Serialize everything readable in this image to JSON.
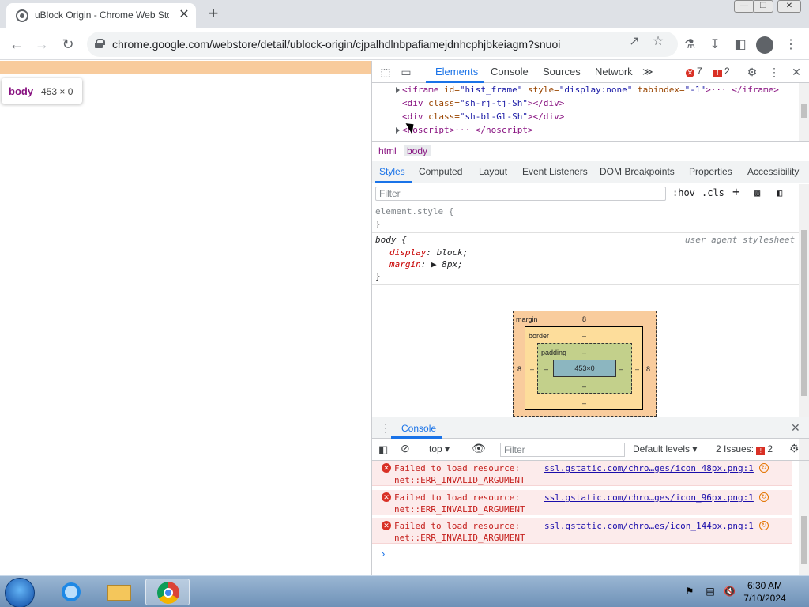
{
  "tab": {
    "title": "uBlock Origin - Chrome Web Sto",
    "close": "✕"
  },
  "newtab": "+",
  "window": {
    "minimize": "—",
    "restore": "❐",
    "close": "✕"
  },
  "address": {
    "url": "chrome.google.com/webstore/detail/ublock-origin/cjpalhdlnbpafiamejdnhcphjbkeiagm?snuoi"
  },
  "tooltip": {
    "tag": "body",
    "dims": "453 × 0"
  },
  "devtools": {
    "tabs": [
      "Elements",
      "Console",
      "Sources",
      "Network"
    ],
    "more": "≫",
    "errors": "7",
    "issues": "2",
    "dom": [
      {
        "open": "<iframe ",
        "attr1": "id=",
        "val1": "\"hist_frame\"",
        "attr2": " style=",
        "val2": "\"display:none\"",
        "attr3": " tabindex=",
        "val3": "\"-1\"",
        "rest": ">··· </iframe>"
      },
      {
        "open": "<div ",
        "attr1": "class=",
        "val1": "\"sh-rj-tj-Sh\"",
        "rest": "></div>"
      },
      {
        "open": "<div ",
        "attr1": "class=",
        "val1": "\"sh-bl-Gl-Sh\"",
        "rest": "></div>"
      },
      {
        "open": "<noscript>",
        "rest": "··· </noscript>"
      }
    ],
    "crumbs": [
      "html",
      "body"
    ],
    "style_tabs": [
      "Styles",
      "Computed",
      "Layout",
      "Event Listeners",
      "DOM Breakpoints",
      "Properties",
      "Accessibility"
    ],
    "filter_placeholder": "Filter",
    "hov": ":hov",
    "cls": ".cls",
    "element_style": "element.style {",
    "close_brace": "}",
    "body_selector": "body {",
    "user_agent": "user agent stylesheet",
    "props": [
      {
        "name": "display",
        "value": "block;"
      },
      {
        "name": "margin",
        "value": "▶ 8px;"
      }
    ],
    "boxmodel": {
      "margin_label": "margin",
      "margin_top": "8",
      "margin_left": "8",
      "margin_right": "8",
      "border_label": "border",
      "border_val": "–",
      "padding_label": "padding",
      "padding_val": "–",
      "content": "453×0",
      "dash": "–"
    }
  },
  "console": {
    "label": "Console",
    "context": "top",
    "filter_placeholder": "Filter",
    "levels": "Default levels",
    "issues_label": "2 Issues:",
    "issues_count": "2",
    "messages": [
      {
        "line1": "Failed to load resource:",
        "line2": "net::ERR_INVALID_ARGUMENT",
        "link": "ssl.gstatic.com/chro…ges/icon_48px.png:1"
      },
      {
        "line1": "Failed to load resource:",
        "line2": "net::ERR_INVALID_ARGUMENT",
        "link": "ssl.gstatic.com/chro…ges/icon_96px.png:1"
      },
      {
        "line1": "Failed to load resource:",
        "line2": "net::ERR_INVALID_ARGUMENT",
        "link": "ssl.gstatic.com/chro…es/icon_144px.png:1"
      }
    ],
    "prompt": "›"
  },
  "taskbar": {
    "time": "6:30 AM",
    "date": "7/10/2024"
  }
}
